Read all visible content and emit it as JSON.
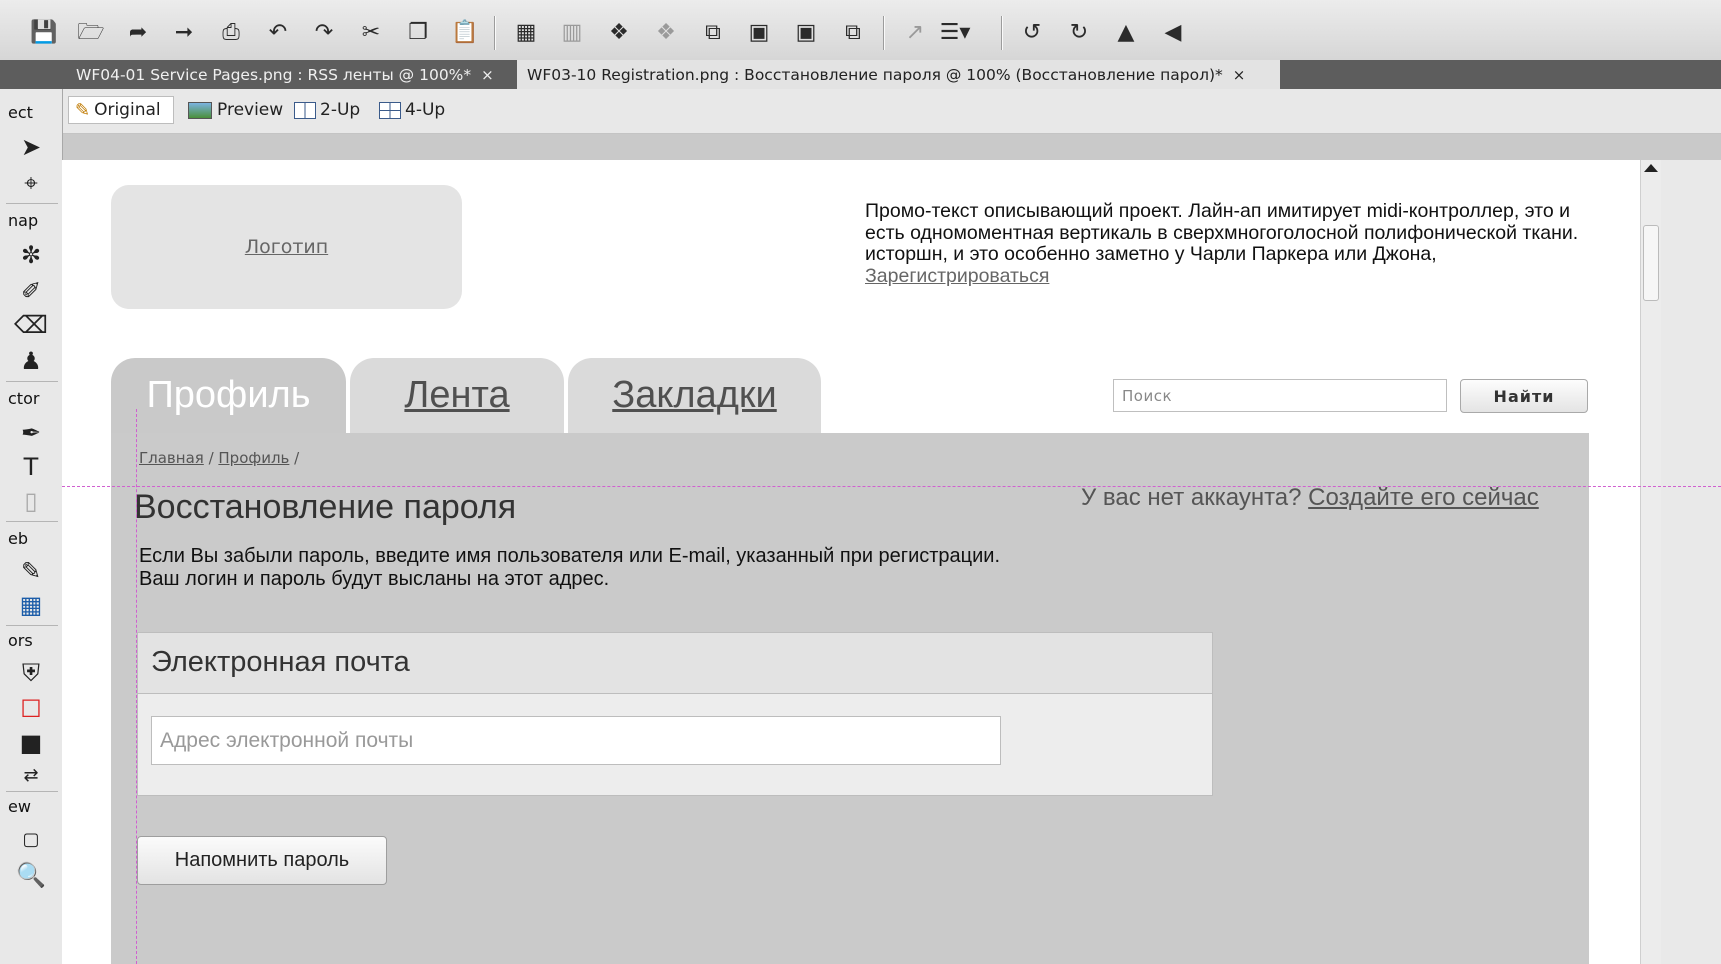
{
  "toolbar": {
    "icons": [
      "save-icon",
      "open-icon",
      "import-icon",
      "export-icon",
      "print-icon",
      "undo-icon",
      "redo-icon",
      "cut-icon",
      "copy-icon",
      "paste-icon",
      "group-icon",
      "ungroup-icon",
      "join-icon",
      "split-icon",
      "bring-forward-icon",
      "bring-front-icon",
      "send-backward-icon",
      "send-back-icon",
      "distribute-icon",
      "align-icon",
      "rotate-left-icon",
      "rotate-right-icon",
      "flip-horizontal-icon",
      "flip-vertical-icon"
    ]
  },
  "tabs": [
    {
      "label": "WF04-01 Service Pages.png : RSS ленты @ 100%*",
      "close": "×"
    },
    {
      "label": "WF03-10 Registration.png : Восстановление пароля @ 100% (Восстановление парол)*",
      "close": "×"
    }
  ],
  "viewbar": {
    "original": "Original",
    "preview": "Preview",
    "two_up": "2-Up",
    "four_up": "4-Up"
  },
  "tools_panel": {
    "sections": [
      "ect",
      "nap",
      "ctor",
      "eb",
      "ors",
      "ew"
    ]
  },
  "page": {
    "logo": "Логотип",
    "promo_text": "Промо-текст описывающий проект. Лайн-ап имитирует midi-контроллер, это и есть одномоментная вертикаль в сверхмногоголосной полифонической ткани. исторшн, и это особенно заметно у Чарли Паркера или Джона,",
    "promo_link": "Зарегистрироваться",
    "tabs": [
      "Профиль",
      "Лента",
      "Закладки"
    ],
    "search_placeholder": "Поиск",
    "search_button": "Найти",
    "breadcrumb": {
      "home": "Главная",
      "sep1": " / ",
      "profile": "Профиль",
      "sep2": " /"
    },
    "title": "Восстановление пароля",
    "no_account": "У вас нет аккаунта?",
    "create_link": "Создайте его сейчас",
    "description": "Если Вы забыли пароль, введите имя пользователя или E-mail, указанный при регистрации. Ваш логин и пароль будут высланы на этот адрес.",
    "field_label": "Электронная почта",
    "email_placeholder": "Адрес электронной почты",
    "remind_button": "Напомнить пароль"
  }
}
